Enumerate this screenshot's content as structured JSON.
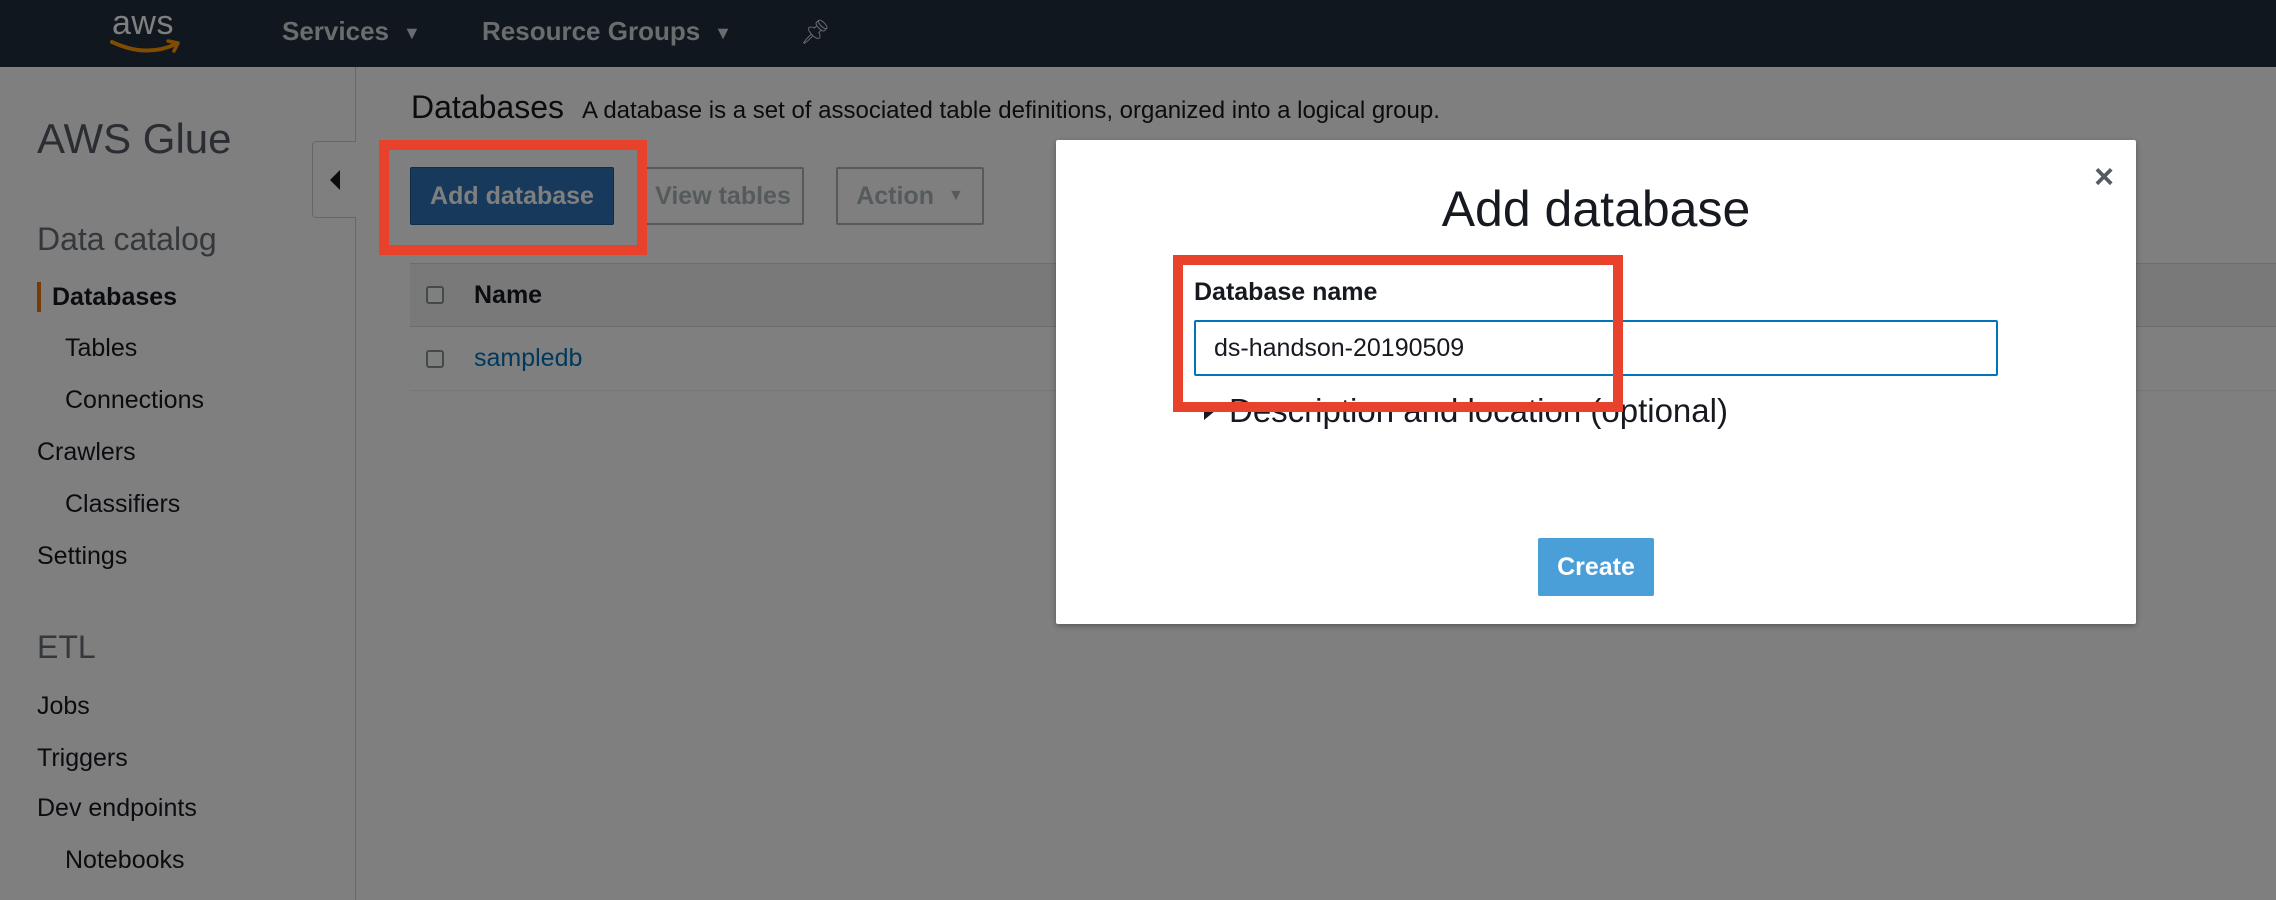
{
  "topnav": {
    "logo_text": "aws",
    "services_label": "Services",
    "resource_groups_label": "Resource Groups"
  },
  "sidebar": {
    "title": "AWS Glue",
    "data_catalog_heading": "Data catalog",
    "items": [
      {
        "label": "Databases"
      },
      {
        "label": "Tables"
      },
      {
        "label": "Connections"
      },
      {
        "label": "Crawlers"
      },
      {
        "label": "Classifiers"
      },
      {
        "label": "Settings"
      }
    ],
    "etl_heading": "ETL",
    "etl_items": [
      {
        "label": "Jobs"
      },
      {
        "label": "Triggers"
      },
      {
        "label": "Dev endpoints"
      },
      {
        "label": "Notebooks"
      }
    ]
  },
  "main": {
    "title": "Databases",
    "description": "A database is a set of associated table definitions, organized into a logical group.",
    "add_button": "Add database",
    "view_tables_button": "View tables",
    "action_button": "Action",
    "table": {
      "header_name": "Name",
      "rows": [
        {
          "name": "sampledb"
        }
      ]
    }
  },
  "modal": {
    "title": "Add database",
    "close_symbol": "×",
    "field_label": "Database name",
    "field_value": "ds-handson-20190509",
    "expander_label": "Description and location (optional)",
    "create_button": "Create"
  },
  "colors": {
    "nav_bg": "#232f3e",
    "primary": "#2e73b8",
    "link": "#0073bb",
    "active_bar": "#ec7211",
    "highlight": "#e8412c"
  }
}
